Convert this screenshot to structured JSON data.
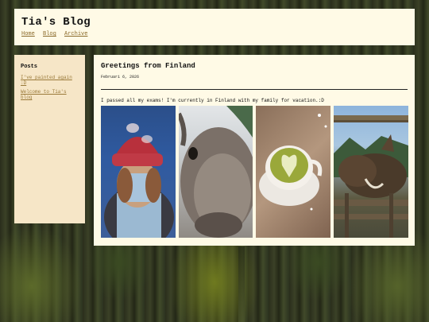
{
  "site": {
    "title": "Tia's Blog",
    "nav": [
      "Home",
      "Blog",
      "Archive"
    ]
  },
  "sidebar": {
    "heading": "Posts",
    "posts": [
      "I've painted again :D",
      "Welcome to Tia's blog"
    ]
  },
  "post": {
    "title": "Greetings from Finland",
    "date": "Februari 6, 2026",
    "body": "I passed all my exams! I'm currently in Finland with my family for vacation.:D"
  },
  "gallery": {
    "photos": [
      "beanie-selfie-photo",
      "reindeer-closeup-photo",
      "matcha-latte-photo",
      "reindeer-fence-photo"
    ]
  },
  "colors": {
    "panel_bg": "#fffae6",
    "sidebar_bg": "#f6e6c7",
    "link": "#8a6a2a"
  }
}
